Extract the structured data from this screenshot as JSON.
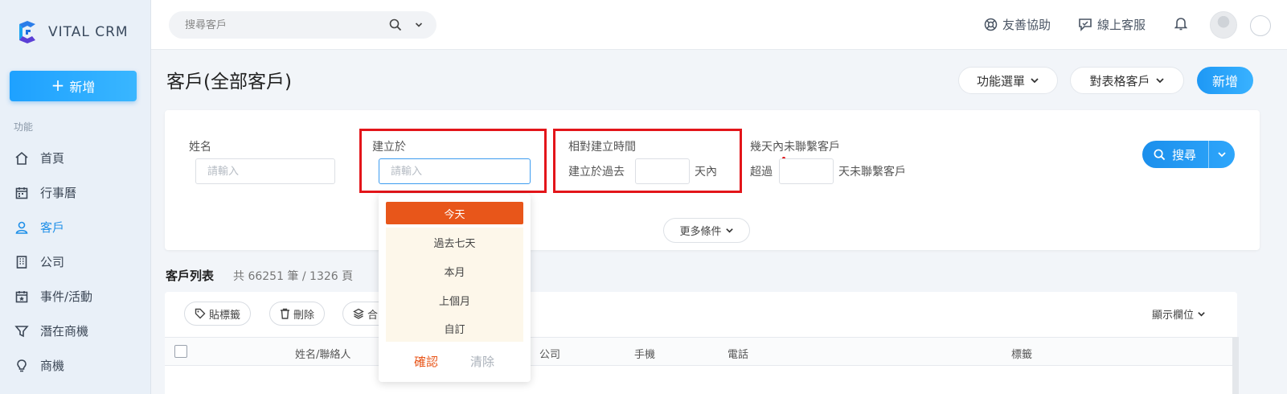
{
  "app": {
    "brand": "VITAL CRM"
  },
  "sidebar": {
    "add_label": "新增",
    "section_label": "功能",
    "items": [
      {
        "label": "首頁",
        "icon": "home-icon"
      },
      {
        "label": "行事曆",
        "icon": "calendar-icon"
      },
      {
        "label": "客戶",
        "icon": "user-icon",
        "active": true
      },
      {
        "label": "公司",
        "icon": "building-icon"
      },
      {
        "label": "事件/活動",
        "icon": "event-icon"
      },
      {
        "label": "潛在商機",
        "icon": "funnel-icon"
      },
      {
        "label": "商機",
        "icon": "lightbulb-icon"
      }
    ]
  },
  "topbar": {
    "search_placeholder": "搜尋客戶",
    "help_label": "友善協助",
    "support_label": "線上客服"
  },
  "page": {
    "title": "客戶(全部客戶)",
    "menu_label": "功能選單",
    "view_label": "對表格客戶",
    "new_label": "新增"
  },
  "filter": {
    "name_label": "姓名",
    "name_placeholder": "請輸入",
    "created_label": "建立於",
    "created_placeholder": "請輸入",
    "relative_label": "相對建立時間",
    "relative_prefix": "建立於過去",
    "relative_suffix": "天內",
    "uncontacted_label": "幾天內未聯繫客戶",
    "uncontacted_prefix": "超過",
    "uncontacted_suffix": "天未聯繫客戶",
    "more_label": "更多條件",
    "search_label": "搜尋"
  },
  "list": {
    "title": "客戶列表",
    "count_text": "共 66251 筆 / 1326 頁",
    "tag_label": "貼標籤",
    "delete_label": "刪除",
    "merge_label": "合",
    "show_columns_label": "顯示欄位",
    "columns": [
      "姓名/聯絡人",
      "公司",
      "手機",
      "電話",
      "標籤"
    ]
  },
  "dropdown": {
    "options": [
      "今天",
      "過去七天",
      "本月",
      "上個月",
      "自訂"
    ],
    "selected": "今天",
    "confirm_label": "確認",
    "clear_label": "清除"
  },
  "colors": {
    "accent": "#1e8fe8",
    "highlight_box": "#e3151a",
    "dropdown_selected": "#e8561a",
    "dropdown_option_bg": "#fdf7ea"
  }
}
